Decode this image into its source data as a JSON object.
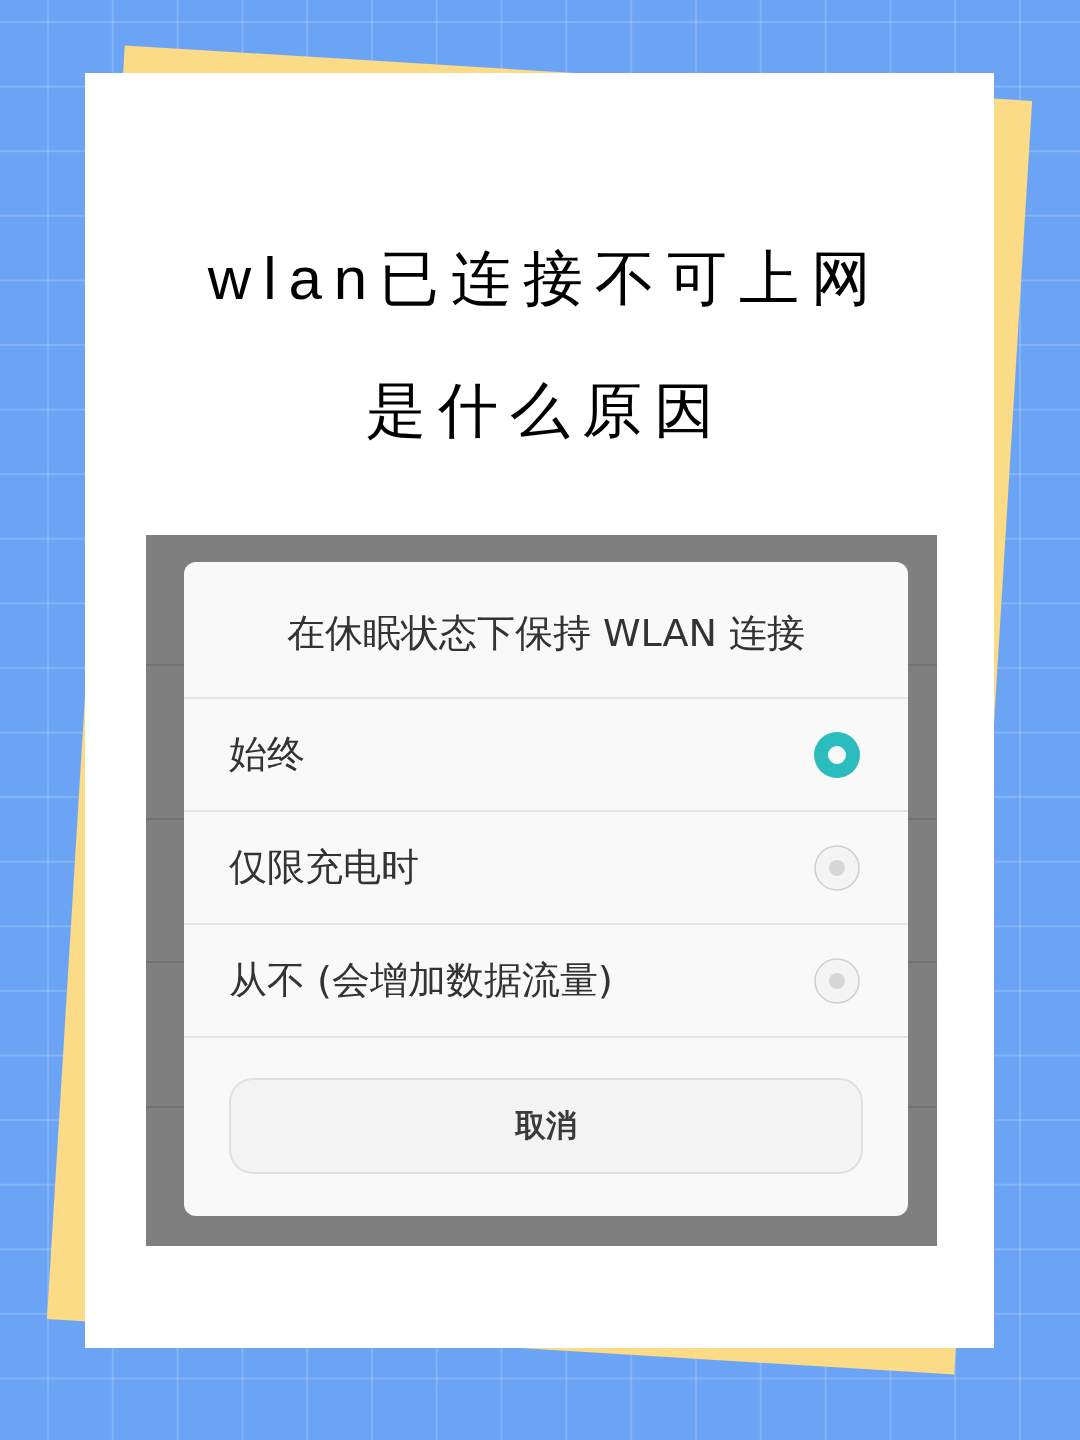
{
  "title": {
    "lines": [
      "wlan已连接不可上网",
      "是什么原因"
    ]
  },
  "screenshot": {
    "dialog": {
      "title": "在休眠状态下保持 WLAN 连接",
      "options": [
        {
          "label": "始终",
          "selected": true
        },
        {
          "label": "仅限充电时",
          "selected": false
        },
        {
          "label": "从不 (会增加数据流量)",
          "selected": false
        }
      ],
      "button": "取消"
    }
  }
}
